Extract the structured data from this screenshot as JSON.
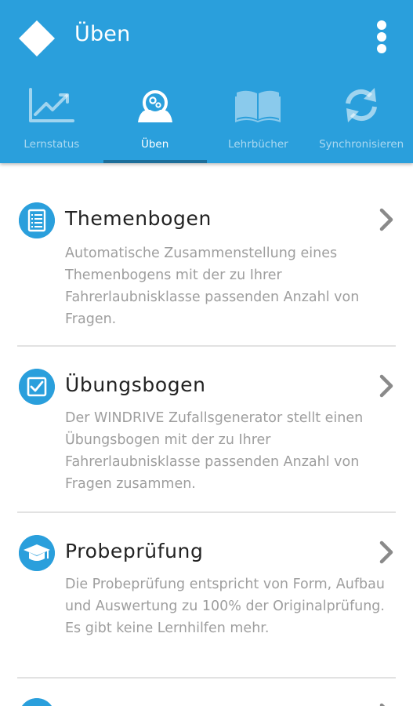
{
  "header": {
    "title": "Üben",
    "colors": {
      "primary": "#2a9fdc",
      "indicator": "#1c6e9a"
    }
  },
  "tabs": [
    {
      "label": "Lernstatus",
      "icon": "line-chart-icon",
      "active": false
    },
    {
      "label": "Üben",
      "icon": "practice-person-gears-icon",
      "active": true
    },
    {
      "label": "Lehrbücher",
      "icon": "open-book-icon",
      "active": false
    },
    {
      "label": "Synchronisieren",
      "icon": "sync-icon",
      "active": false
    }
  ],
  "items": [
    {
      "title": "Themenbogen",
      "icon": "list-document-icon",
      "description": "Automatische Zusammenstellung eines Themenbogens mit der zu Ihrer Fahrerlaubnisklasse passenden Anzahl von Fragen."
    },
    {
      "title": "Übungsbogen",
      "icon": "checkbox-icon",
      "description": "Der WINDRIVE Zufallsgenerator stellt einen Übungsbogen mit der zu Ihrer Fahrerlaubnisklasse passenden Anzahl von Fragen zusammen."
    },
    {
      "title": "Probeprüfung",
      "icon": "graduation-cap-icon",
      "description": "Die Probeprüfung entspricht von Form, Aufbau und Auswertung zu 100% der Originalprüfung. Es gibt keine Lernhilfen mehr."
    }
  ]
}
